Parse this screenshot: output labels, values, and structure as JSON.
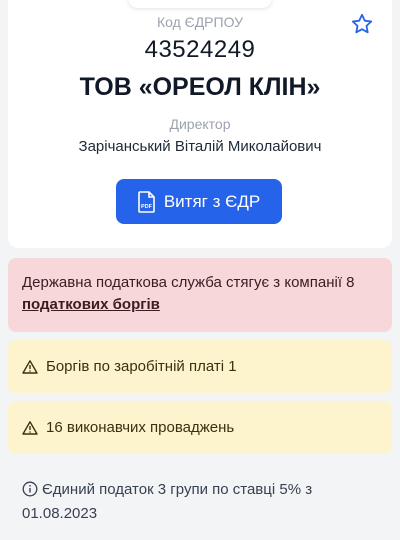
{
  "header": {
    "code_label": "Код ЄДРПОУ",
    "code_value": "43524249",
    "company_name": "ТОВ «ОРЕОЛ КЛІН»",
    "role_label": "Директор",
    "director_name": "Зарічанський Віталій Миколайович",
    "extract_button": "Витяг з ЄДР",
    "favorite_icon": "star-outline-icon",
    "pdf_icon": "pdf-file-icon"
  },
  "alerts": {
    "tax": {
      "text": "Державна податкова служба стягує з компанії 8",
      "link": "податкових боргів"
    },
    "salary_debts": "Боргів по заробітній платі 1",
    "enforcement": "16 виконавчих проваджень",
    "warning_icon": "warning-triangle-icon"
  },
  "info": {
    "text": "Єдиний податок 3 групи по ставці 5% з 01.08.2023",
    "icon": "info-circle-icon"
  },
  "colors": {
    "accent": "#2563eb",
    "danger_bg": "#f8d7da",
    "warning_bg": "#fdf3cd"
  }
}
